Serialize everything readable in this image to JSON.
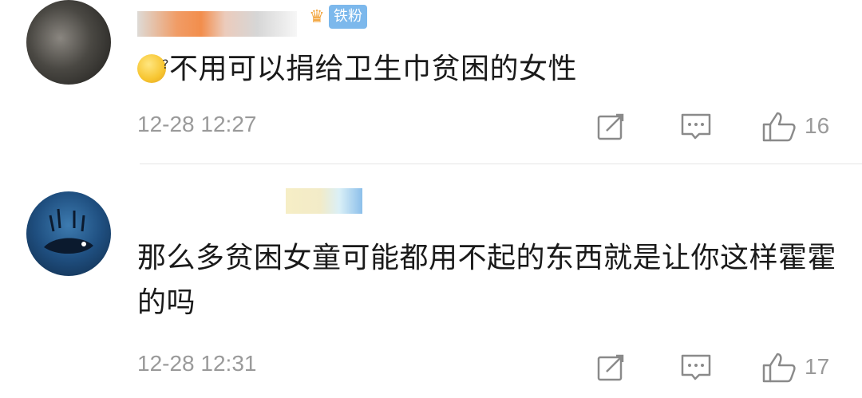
{
  "comments": [
    {
      "badge_label": "铁粉",
      "text": "不用可以捐给卫生巾贫困的女性",
      "timestamp": "12-28 12:27",
      "like_count": "16",
      "icons": [
        "forward-icon",
        "comment-icon",
        "like-icon"
      ]
    },
    {
      "text": "那么多贫困女童可能都用不起的东西就是让你这样霍霍的吗",
      "timestamp": "12-28 12:31",
      "like_count": "17",
      "icons": [
        "forward-icon",
        "comment-icon",
        "like-icon"
      ]
    }
  ],
  "colors": {
    "badge_bg": "#7cb8ec",
    "meta_text": "#9a9a9a",
    "body_text": "#1a1a1a"
  }
}
